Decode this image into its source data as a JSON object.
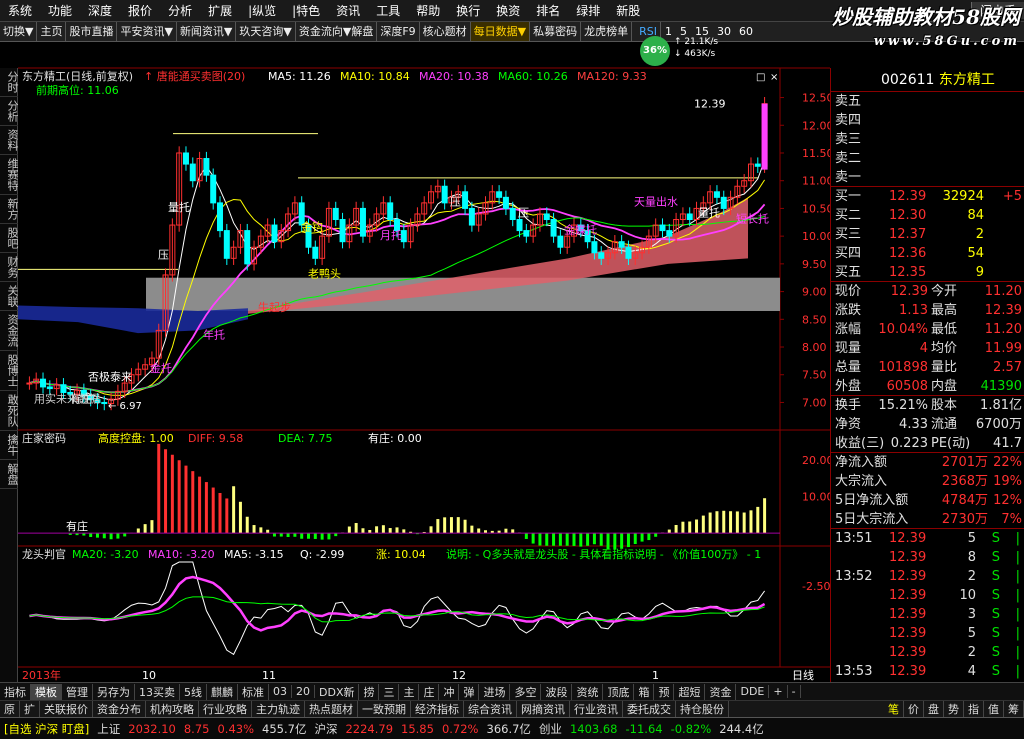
{
  "menu": [
    "系统",
    "功能",
    "深度",
    "报价",
    "分析",
    "扩展",
    "|纵览",
    "|特色",
    "资讯",
    "工具",
    "帮助",
    "换行",
    "换资",
    "排名",
    "绿排",
    "新股"
  ],
  "menu_right": "闪电手",
  "toolbar": {
    "items": [
      "切换▼",
      "主页",
      "股市直播",
      "平安资讯▼",
      "新闻资讯▼",
      "玖天咨询▼",
      "资金流向▼解盘",
      "深度F9",
      "核心题材",
      "每日数据▼",
      "私募密码",
      "龙虎榜单"
    ],
    "periods": [
      "1",
      "5",
      "15",
      "30",
      "60"
    ],
    "period_last": "季"
  },
  "logo": {
    "title": "炒股辅助教材58股网",
    "url": "www.58Gu.com"
  },
  "network": {
    "percent": "36%",
    "up": "21.1K/s",
    "down": "463K/s"
  },
  "leftnav": [
    "分时",
    "分析",
    "资料",
    "维赛特",
    "新方",
    "股吧",
    "财务",
    "关联",
    "资金流",
    "股博士",
    "敢死队",
    "擒牛",
    "解盘"
  ],
  "chart_data": [
    {
      "type": "candlestick",
      "title": "东方精工(日线,前复权)",
      "indicator": "唐能通买卖图(20)",
      "legend": [
        {
          "name": "MA5",
          "value": "11.26",
          "color": "#ffffff"
        },
        {
          "name": "MA10",
          "value": "10.84",
          "color": "#ffff00"
        },
        {
          "name": "MA20",
          "value": "10.38",
          "color": "#ff40ff"
        },
        {
          "name": "MA60",
          "value": "10.26",
          "color": "#00ff00"
        },
        {
          "name": "MA120",
          "value": "9.33",
          "color": "#ff4040"
        }
      ],
      "prev_high_label": "前期高位: 11.06",
      "ylim": [
        6.9,
        12.6
      ],
      "yticks": [
        "12.50",
        "12.00",
        "11.50",
        "11.00",
        "10.50",
        "10.00",
        "9.50",
        "9.00",
        "8.50",
        "8.00",
        "7.50",
        "7.00"
      ],
      "last_price": "12.39",
      "low_label": "6.97",
      "annotations": [
        "量托",
        "否极泰来",
        "月托",
        "老鸭头",
        "金钩",
        "年托",
        "牛起步",
        "天量出水",
        "量托",
        "金托",
        "短长托",
        "压",
        "压",
        "压",
        "金蝶托",
        "有庄",
        "用实未来数据"
      ],
      "close": [
        7.35,
        7.42,
        7.28,
        7.25,
        7.32,
        7.18,
        7.15,
        7.22,
        7.12,
        7.05,
        7.0,
        6.98,
        7.06,
        7.2,
        7.35,
        7.5,
        7.6,
        7.68,
        7.8,
        8.3,
        9.3,
        10.2,
        11.5,
        11.3,
        11.0,
        11.4,
        11.1,
        10.6,
        10.1,
        9.6,
        9.8,
        10.1,
        9.5,
        9.8,
        10.0,
        10.2,
        9.9,
        10.1,
        10.4,
        10.6,
        10.2,
        9.8,
        9.6,
        10.0,
        10.5,
        10.3,
        9.9,
        10.2,
        10.5,
        10.0,
        10.2,
        10.4,
        10.6,
        10.3,
        10.1,
        9.9,
        10.2,
        10.4,
        10.6,
        10.8,
        10.9,
        10.6,
        10.7,
        10.8,
        10.5,
        10.2,
        10.4,
        10.6,
        10.8,
        10.7,
        10.5,
        10.3,
        10.1,
        10.0,
        10.2,
        10.4,
        10.3,
        10.0,
        9.8,
        10.0,
        10.2,
        10.1,
        9.9,
        9.7,
        9.6,
        9.7,
        9.9,
        9.8,
        9.6,
        9.7,
        9.8,
        10.0,
        10.2,
        10.1,
        10.0,
        10.3,
        10.4,
        10.3,
        10.5,
        10.6,
        10.8,
        10.7,
        10.5,
        10.7,
        10.9,
        11.0,
        11.3,
        11.26,
        12.39
      ]
    },
    {
      "type": "bar",
      "title": "庄家密码",
      "labels": [
        {
          "name": "高度控盘",
          "value": "1.00"
        },
        {
          "name": "DIFF",
          "value": "9.58"
        },
        {
          "name": "DEA",
          "value": "7.75"
        },
        {
          "name": "有庄",
          "value": "0.00"
        }
      ],
      "yticks": [
        "20.00",
        "10.00"
      ],
      "ylim": [
        -3,
        25
      ]
    },
    {
      "type": "line",
      "title": "龙头判官",
      "labels": [
        {
          "name": "MA20",
          "value": "-3.20"
        },
        {
          "name": "MA10",
          "value": "-3.20"
        },
        {
          "name": "MA5",
          "value": "-3.15"
        },
        {
          "name": "Q",
          "value": "-2.99"
        },
        {
          "name": "涨",
          "value": "10.04"
        }
      ],
      "note": "说明: - Q多头就是龙头股 - 具体看指标说明 - 《价值100万》 - 1",
      "yticks": [
        "-2.50"
      ]
    }
  ],
  "xaxis": [
    "2013年",
    "10",
    "11",
    "12",
    "1"
  ],
  "period_label": "日线",
  "stock": {
    "code": "002611",
    "name": "东方精工"
  },
  "orderbook": {
    "asks": [
      {
        "label": "卖五"
      },
      {
        "label": "卖四"
      },
      {
        "label": "卖三"
      },
      {
        "label": "卖二"
      },
      {
        "label": "卖一"
      }
    ],
    "bids": [
      {
        "label": "买一",
        "price": "12.39",
        "vol": "32924",
        "chg": "+5"
      },
      {
        "label": "买二",
        "price": "12.30",
        "vol": "84"
      },
      {
        "label": "买三",
        "price": "12.37",
        "vol": "2"
      },
      {
        "label": "买四",
        "price": "12.36",
        "vol": "54"
      },
      {
        "label": "买五",
        "price": "12.35",
        "vol": "9"
      }
    ]
  },
  "quote": [
    {
      "k1": "现价",
      "v1": "12.39",
      "k2": "今开",
      "v2": "11.20"
    },
    {
      "k1": "涨跌",
      "v1": "1.13",
      "k2": "最高",
      "v2": "12.39"
    },
    {
      "k1": "涨幅",
      "v1": "10.04%",
      "k2": "最低",
      "v2": "11.20"
    },
    {
      "k1": "现量",
      "v1": "4",
      "k2": "均价",
      "v2": "11.99"
    },
    {
      "k1": "总量",
      "v1": "101898",
      "k2": "量比",
      "v2": "2.57"
    },
    {
      "k1": "外盘",
      "v1": "60508",
      "k2": "内盘",
      "v2": "41390"
    }
  ],
  "fundamentals": [
    {
      "k1": "换手",
      "v1": "15.21%",
      "k2": "股本",
      "v2": "1.81亿"
    },
    {
      "k1": "净资",
      "v1": "4.33",
      "k2": "流通",
      "v2": "6700万"
    },
    {
      "k1": "收益(三)",
      "v1": "0.223",
      "k2": "PE(动)",
      "v2": "41.7"
    }
  ],
  "flows": [
    {
      "k": "净流入额",
      "v": "2701万",
      "p": "22%"
    },
    {
      "k": "大宗流入",
      "v": "2368万",
      "p": "19%"
    },
    {
      "k": "5日净流入额",
      "v": "4784万",
      "p": "12%"
    },
    {
      "k": "5日大宗流入",
      "v": "2730万",
      "p": "7%"
    }
  ],
  "ticks": [
    {
      "t": "13:51",
      "p": "12.39",
      "v": "5",
      "s": "S"
    },
    {
      "t": "",
      "p": "12.39",
      "v": "8",
      "s": "S"
    },
    {
      "t": "13:52",
      "p": "12.39",
      "v": "2",
      "s": "S"
    },
    {
      "t": "",
      "p": "12.39",
      "v": "10",
      "s": "S"
    },
    {
      "t": "",
      "p": "12.39",
      "v": "3",
      "s": "S"
    },
    {
      "t": "",
      "p": "12.39",
      "v": "5",
      "s": "S"
    },
    {
      "t": "",
      "p": "12.39",
      "v": "2",
      "s": "S"
    },
    {
      "t": "13:53",
      "p": "12.39",
      "v": "4",
      "s": "S"
    }
  ],
  "bottomtabs": [
    "指标",
    "模板",
    "管理",
    "另存为",
    "13买卖",
    "5线",
    "麒麟",
    "标准",
    "03",
    "20",
    "DDX新",
    "捞",
    "三",
    "主",
    "庄",
    "冲",
    "弹",
    "进场",
    "多空",
    "波段",
    "资统",
    "顶底",
    "箱",
    "预",
    "超短",
    "资金",
    "DDE",
    "+",
    "-"
  ],
  "bottomtabs2": [
    "原",
    "扩",
    "关联报价",
    "资金分布",
    "机构攻略",
    "行业攻略",
    "主力轨迹",
    "热点题材",
    "一致预期",
    "经济指标",
    "综合资讯",
    "网摘资讯",
    "行业资讯",
    "委托成交",
    "持仓股份"
  ],
  "right_small_tabs": [
    "笔",
    "价",
    "盘",
    "势",
    "指",
    "值",
    "筹"
  ],
  "status": [
    {
      "t": "[自选 沪深 盯盘]",
      "c": "#ffff00"
    },
    {
      "t": "上证",
      "c": "#ddd"
    },
    {
      "t": "2032.10",
      "c": "#ff3030"
    },
    {
      "t": "8.75",
      "c": "#ff3030"
    },
    {
      "t": "0.43%",
      "c": "#ff3030"
    },
    {
      "t": "455.7亿",
      "c": "#ddd"
    },
    {
      "t": "沪深",
      "c": "#ddd"
    },
    {
      "t": "2224.79",
      "c": "#ff3030"
    },
    {
      "t": "15.85",
      "c": "#ff3030"
    },
    {
      "t": "0.72%",
      "c": "#ff3030"
    },
    {
      "t": "366.7亿",
      "c": "#ddd"
    },
    {
      "t": "创业",
      "c": "#ddd"
    },
    {
      "t": "1403.68",
      "c": "#00e000"
    },
    {
      "t": "-11.64",
      "c": "#00e000"
    },
    {
      "t": "-0.82%",
      "c": "#00e000"
    },
    {
      "t": "244.4亿",
      "c": "#ddd"
    }
  ]
}
